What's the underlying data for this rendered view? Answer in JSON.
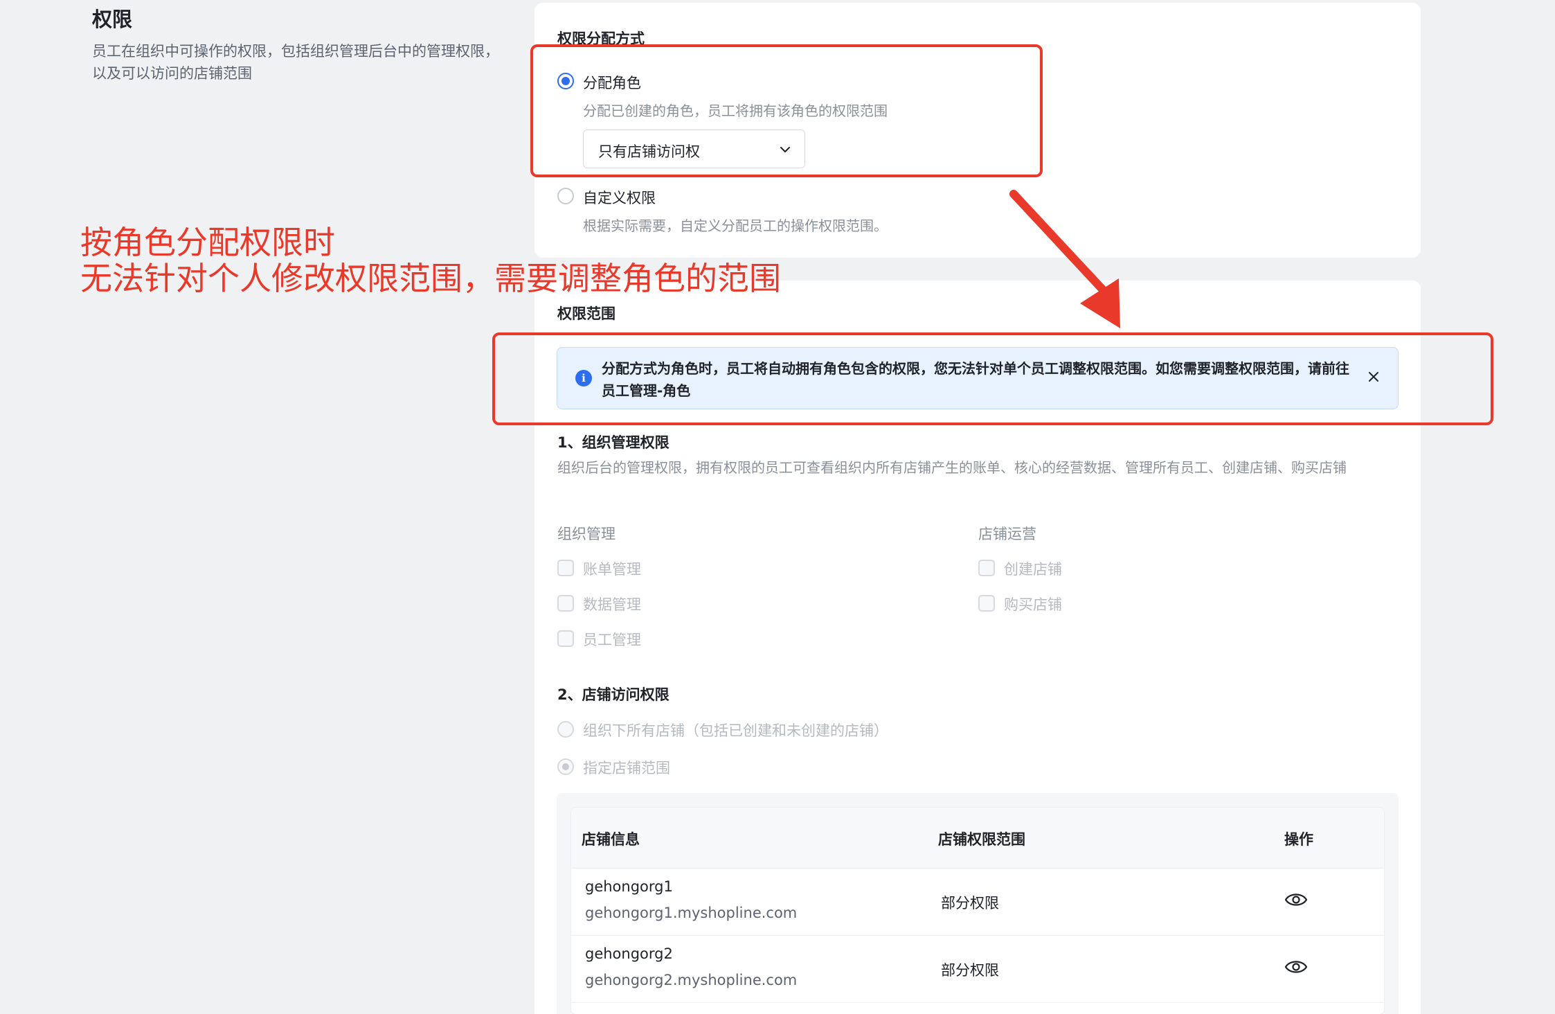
{
  "left": {
    "title": "权限",
    "description": "员工在组织中可操作的权限，包括组织管理后台中的管理权限，以及可以访问的店铺范围"
  },
  "assign": {
    "title": "权限分配方式",
    "role_label": "分配角色",
    "role_desc": "分配已创建的角色，员工将拥有该角色的权限范围",
    "role_select_value": "只有店铺访问权",
    "custom_label": "自定义权限",
    "custom_desc": "根据实际需要，自定义分配员工的操作权限范围。"
  },
  "annotation": {
    "line1": "按角色分配权限时",
    "line2": "无法针对个人修改权限范围，需要调整角色的范围",
    "color": "#e8392a"
  },
  "scope": {
    "title": "权限范围",
    "alert_text": "分配方式为角色时，员工将自动拥有角色包含的权限，您无法针对单个员工调整权限范围。如您需要调整权限范围，请前往员工管理-角色",
    "org_title": "1、组织管理权限",
    "org_desc": "组织后台的管理权限，拥有权限的员工可查看组织内所有店铺产生的账单、核心的经营数据、管理所有员工、创建店铺、购买店铺",
    "group_org": "组织管理",
    "group_shop": "店铺运营",
    "org_items": [
      "账单管理",
      "数据管理",
      "员工管理"
    ],
    "shop_items": [
      "创建店铺",
      "购买店铺"
    ],
    "access_title": "2、店铺访问权限",
    "access_all": "组织下所有店铺（包括已创建和未创建的店铺）",
    "access_specified": "指定店铺范围"
  },
  "table": {
    "headers": [
      "店铺信息",
      "店铺权限范围",
      "操作"
    ],
    "rows": [
      {
        "name": "gehongorg1",
        "url": "gehongorg1.myshopline.com",
        "perm": "部分权限"
      },
      {
        "name": "gehongorg2",
        "url": "gehongorg2.myshopline.com",
        "perm": "部分权限"
      }
    ]
  },
  "colors": {
    "accent": "#2d6df0",
    "annotation_red": "#e8392a"
  }
}
